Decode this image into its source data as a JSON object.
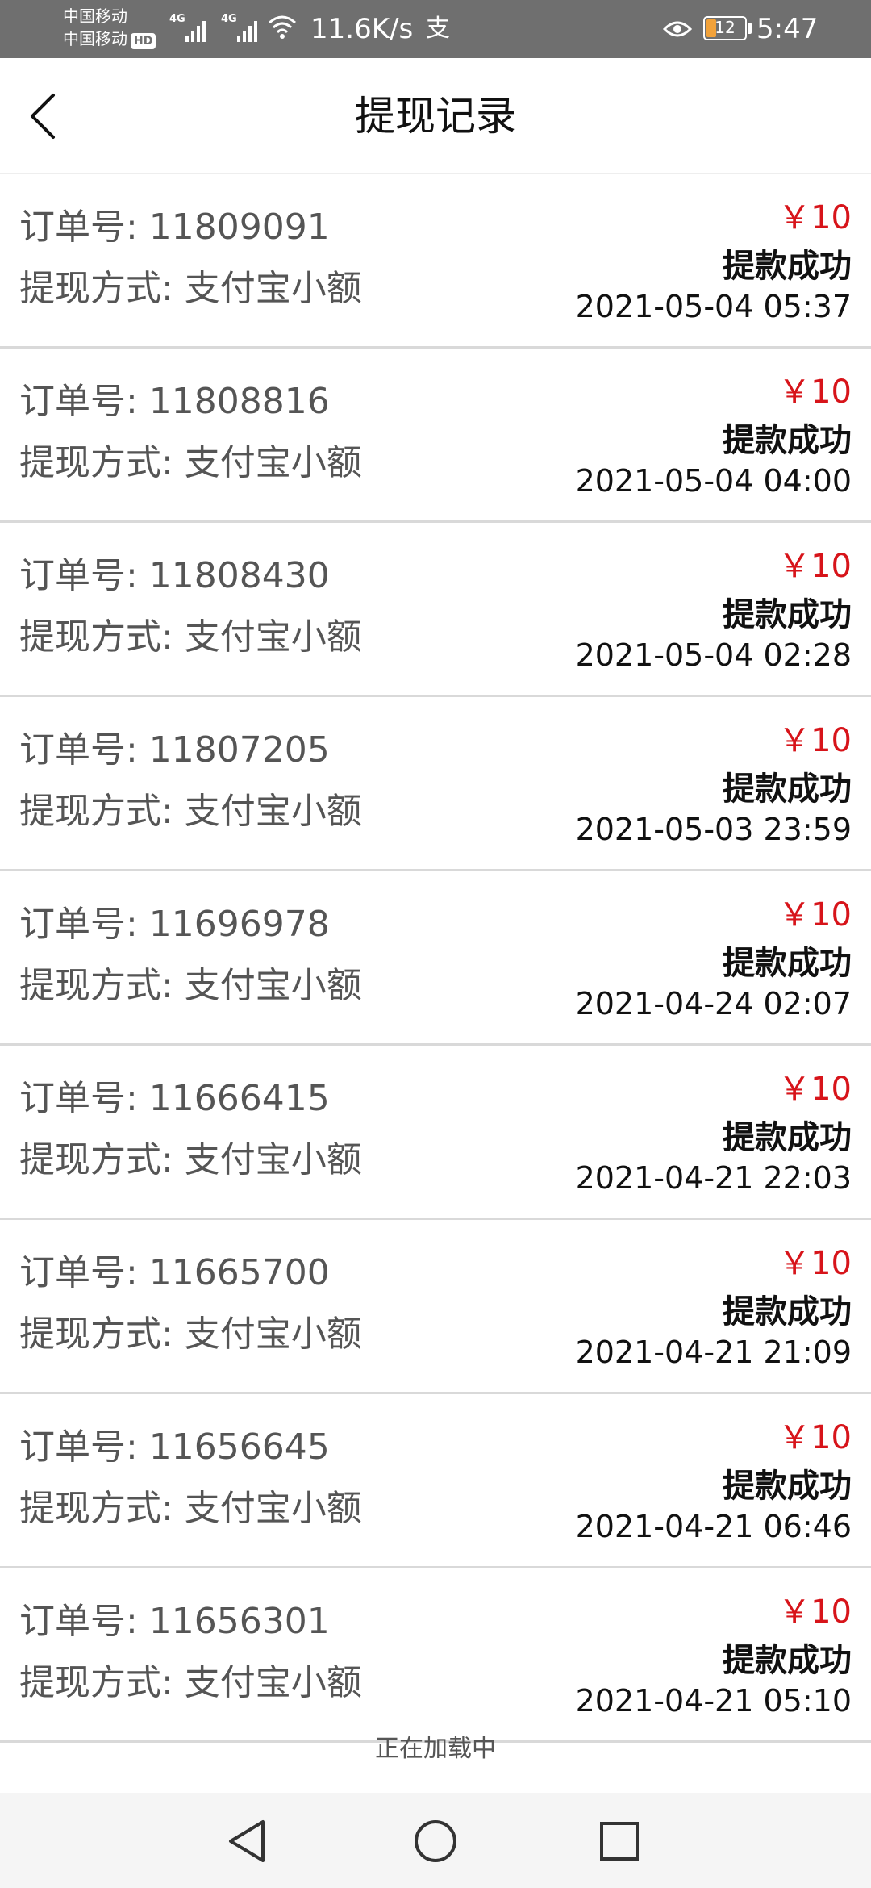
{
  "status_bar": {
    "carrier_1": "中国移动",
    "carrier_2": "中国移动",
    "hd": "HD",
    "signal_label": "4G",
    "net_speed": "11.6K/s",
    "extra_icon_text": "支",
    "battery_level": "12",
    "time": "5:47"
  },
  "header": {
    "title": "提现记录",
    "back_icon": "chevron-left-icon"
  },
  "records": [
    {
      "order_label": "订单号: 11809091",
      "method_label": "提现方式: 支付宝小额",
      "amount": "￥10",
      "status": "提款成功",
      "time": "2021-05-04 05:37"
    },
    {
      "order_label": "订单号: 11808816",
      "method_label": "提现方式: 支付宝小额",
      "amount": "￥10",
      "status": "提款成功",
      "time": "2021-05-04 04:00"
    },
    {
      "order_label": "订单号: 11808430",
      "method_label": "提现方式: 支付宝小额",
      "amount": "￥10",
      "status": "提款成功",
      "time": "2021-05-04 02:28"
    },
    {
      "order_label": "订单号: 11807205",
      "method_label": "提现方式: 支付宝小额",
      "amount": "￥10",
      "status": "提款成功",
      "time": "2021-05-03 23:59"
    },
    {
      "order_label": "订单号: 11696978",
      "method_label": "提现方式: 支付宝小额",
      "amount": "￥10",
      "status": "提款成功",
      "time": "2021-04-24 02:07"
    },
    {
      "order_label": "订单号: 11666415",
      "method_label": "提现方式: 支付宝小额",
      "amount": "￥10",
      "status": "提款成功",
      "time": "2021-04-21 22:03"
    },
    {
      "order_label": "订单号: 11665700",
      "method_label": "提现方式: 支付宝小额",
      "amount": "￥10",
      "status": "提款成功",
      "time": "2021-04-21 21:09"
    },
    {
      "order_label": "订单号: 11656645",
      "method_label": "提现方式: 支付宝小额",
      "amount": "￥10",
      "status": "提款成功",
      "time": "2021-04-21 06:46"
    },
    {
      "order_label": "订单号: 11656301",
      "method_label": "提现方式: 支付宝小额",
      "amount": "￥10",
      "status": "提款成功",
      "time": "2021-04-21 05:10"
    }
  ],
  "loading_text": "正在加载中",
  "colors": {
    "status_bar_bg": "#6f6f6f",
    "amount": "#d7141a",
    "divider": "#d9d9d9",
    "nav_bg": "#f5f5f5"
  },
  "nav_icons": [
    "nav-back-icon",
    "nav-home-icon",
    "nav-recent-icon"
  ]
}
